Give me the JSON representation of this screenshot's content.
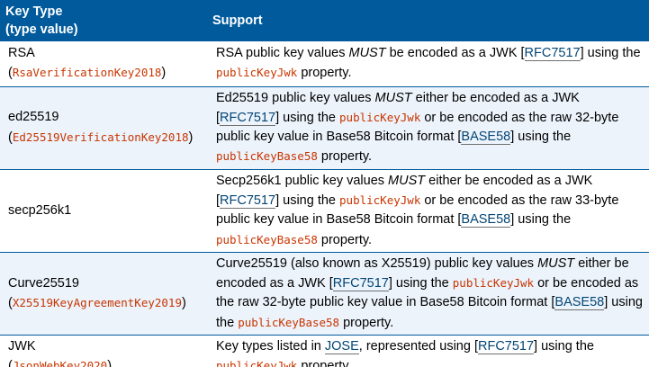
{
  "header": {
    "col1_line1": "Key Type",
    "col1_line2": "(type value)",
    "col2": "Support"
  },
  "rows": [
    {
      "key_name": "RSA",
      "type_value": "RsaVerificationKey2018",
      "s1": "RSA public key values ",
      "must": "MUST",
      "s2": " be encoded as a JWK [",
      "ref1": "RFC7517",
      "s3": "] using the ",
      "code1": "publicKeyJwk",
      "s4": " property."
    },
    {
      "key_name": "ed25519",
      "type_value": "Ed25519VerificationKey2018",
      "s1": "Ed25519 public key values ",
      "must": "MUST",
      "s2": " either be encoded as a JWK [",
      "ref1": "RFC7517",
      "s3": "] using the ",
      "code1": "publicKeyJwk",
      "s4": " or be encoded as the raw 32-byte public key value in Base58 Bitcoin format [",
      "ref2": "BASE58",
      "s5": "] using the ",
      "code2": "publicKeyBase58",
      "s6": " property."
    },
    {
      "key_name": "secp256k1",
      "s1": "Secp256k1 public key values ",
      "must": "MUST",
      "s2": " either be encoded as a JWK [",
      "ref1": "RFC7517",
      "s3": "] using the ",
      "code1": "publicKeyJwk",
      "s4": " or be encoded as the raw 33-byte public key value in Base58 Bitcoin format [",
      "ref2": "BASE58",
      "s5": "] using the ",
      "code2": "publicKeyBase58",
      "s6": " property."
    },
    {
      "key_name": "Curve25519",
      "type_value": "X25519KeyAgreementKey2019",
      "s1": "Curve25519 (also known as X25519) public key values ",
      "must": "MUST",
      "s2": " either be encoded as a JWK [",
      "ref1": "RFC7517",
      "s3": "] using the ",
      "code1": "publicKeyJwk",
      "s4": " or be encoded as the raw 32-byte public key value in Base58 Bitcoin format [",
      "ref2": "BASE58",
      "s5": "] using the ",
      "code2": "publicKeyBase58",
      "s6": " property."
    },
    {
      "key_name": "JWK",
      "type_value": "JsonWebKey2020",
      "s1": "Key types listed in ",
      "ref0": "JOSE",
      "s2": ", represented using [",
      "ref1": "RFC7517",
      "s3": "] using the ",
      "code1": "publicKeyJwk",
      "s4": " property."
    }
  ],
  "colors": {
    "header_bg": "#005a9c",
    "row_alt_bg": "#ecf3fb",
    "code": "#c83500",
    "link": "#034575"
  }
}
